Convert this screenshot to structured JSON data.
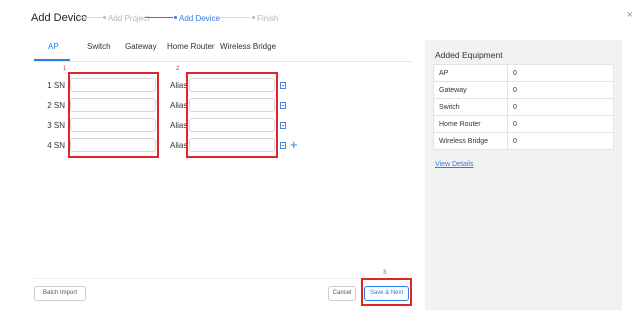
{
  "dialog": {
    "title": "Add Device",
    "close_icon": "×"
  },
  "steps": [
    {
      "label": "Add Project",
      "state": "done"
    },
    {
      "label": "Add Device",
      "state": "active"
    },
    {
      "label": "Finish",
      "state": "pending"
    }
  ],
  "tabs": [
    {
      "label": "AP",
      "active": true
    },
    {
      "label": "Switch",
      "active": false
    },
    {
      "label": "Gateway",
      "active": false
    },
    {
      "label": "Home Router",
      "active": false
    },
    {
      "label": "Wireless Bridge",
      "active": false
    }
  ],
  "annotations": {
    "sn_box": "1",
    "alias_box": "2",
    "save_box": "3"
  },
  "rows": [
    {
      "sn_label": "1 SN",
      "sn_value": "",
      "alias_label": "Alias",
      "alias_value": ""
    },
    {
      "sn_label": "2 SN",
      "sn_value": "",
      "alias_label": "Alias",
      "alias_value": ""
    },
    {
      "sn_label": "3 SN",
      "sn_value": "",
      "alias_label": "Alias",
      "alias_value": ""
    },
    {
      "sn_label": "4 SN",
      "sn_value": "",
      "alias_label": "Alias",
      "alias_value": ""
    }
  ],
  "add_row_icon": "+",
  "footer": {
    "batch_import": "Batch Import",
    "cancel": "Cancel",
    "save_next": "Save & Next"
  },
  "added_equipment": {
    "title": "Added Equipment",
    "items": [
      {
        "name": "AP",
        "count": "0"
      },
      {
        "name": "Gateway",
        "count": "0"
      },
      {
        "name": "Switch",
        "count": "0"
      },
      {
        "name": "Home Router",
        "count": "0"
      },
      {
        "name": "Wireless Bridge",
        "count": "0"
      }
    ],
    "view_details": "View Details"
  },
  "colors": {
    "accent": "#2b7de9",
    "annotation_red": "#e0242a",
    "panel_bg": "#f2f2f2"
  }
}
